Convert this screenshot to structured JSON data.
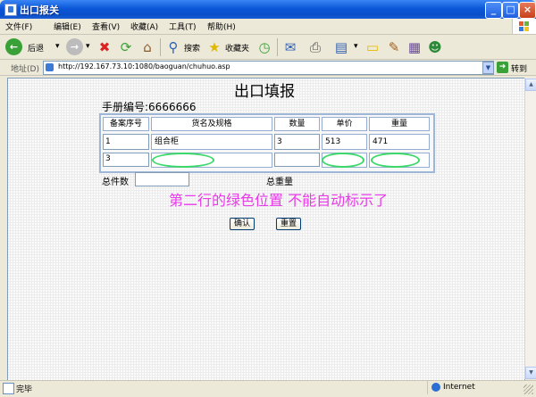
{
  "window": {
    "title": "出口报关"
  },
  "menu": {
    "items": [
      "文件(F)",
      "编辑(E)",
      "查看(V)",
      "收藏(A)",
      "工具(T)",
      "帮助(H)"
    ]
  },
  "toolbar": {
    "back": "后退",
    "search": "搜索",
    "favorites": "收藏夹"
  },
  "address": {
    "label": "地址(D)",
    "url": "http://192.167.73.10:1080/baoguan/chuhuo.asp",
    "go": "转到"
  },
  "page": {
    "title": "出口填报",
    "manual_label": "手册编号:",
    "manual_no": "6666666",
    "table": {
      "headers": [
        "备案序号",
        "货名及规格",
        "数量",
        "单价",
        "重量"
      ],
      "rows": [
        [
          "1",
          "组合柜",
          "3",
          "513",
          "471"
        ],
        [
          "3",
          "",
          "",
          "",
          ""
        ]
      ]
    },
    "total_pieces_label": "总件数",
    "total_weight_label": "总重量",
    "annotation": "第二行的绿色位置  不能自动标示了",
    "confirm": "确认",
    "reset": "重置"
  },
  "status": {
    "text": "完毕",
    "zone": "Internet"
  },
  "colors": {
    "annotation": "#e83ae8",
    "highlight_oval": "#3cd96a",
    "titlebar": "#0b57d8"
  }
}
